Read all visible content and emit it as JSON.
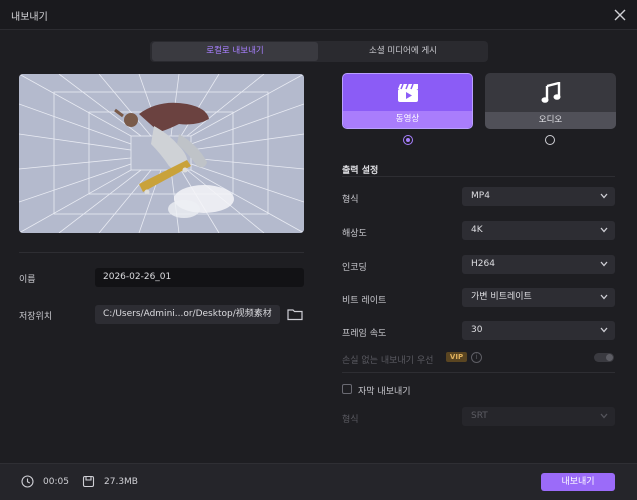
{
  "window": {
    "title": "내보내기"
  },
  "tabs": [
    {
      "label": "로컬로 내보내기",
      "active": true
    },
    {
      "label": "소셜 미디어에 게시",
      "active": false
    }
  ],
  "file": {
    "name_label": "이름",
    "name_value": "2026-02-26_01",
    "location_label": "저장위치",
    "location_value": "C:/Users/Admini...or/Desktop/视频素材"
  },
  "types": [
    {
      "label": "동영상",
      "icon": "video-clapper-icon",
      "selected": true
    },
    {
      "label": "오디오",
      "icon": "music-note-icon",
      "selected": false
    }
  ],
  "output": {
    "section_title": "출력 설정",
    "rows": [
      {
        "label": "형식",
        "value": "MP4"
      },
      {
        "label": "해상도",
        "value": "4K"
      },
      {
        "label": "인코딩",
        "value": "H264"
      },
      {
        "label": "비트 레이트",
        "value": "가변 비트레이트"
      },
      {
        "label": "프레임 속도",
        "value": "30"
      }
    ],
    "lossless_label": "손실 없는 내보내기 우선",
    "vip_badge": "VIP",
    "info_glyph": "i",
    "lossless_enabled": false
  },
  "subtitle": {
    "checkbox_label": "자막 내보내기",
    "format_label": "형식",
    "format_value": "SRT"
  },
  "footer": {
    "duration": "00:05",
    "size": "27.3MB",
    "export_label": "내보내기"
  },
  "colors": {
    "accent": "#9b6bf9",
    "accent_text": "#a880ff",
    "background": "#1e1e22"
  }
}
